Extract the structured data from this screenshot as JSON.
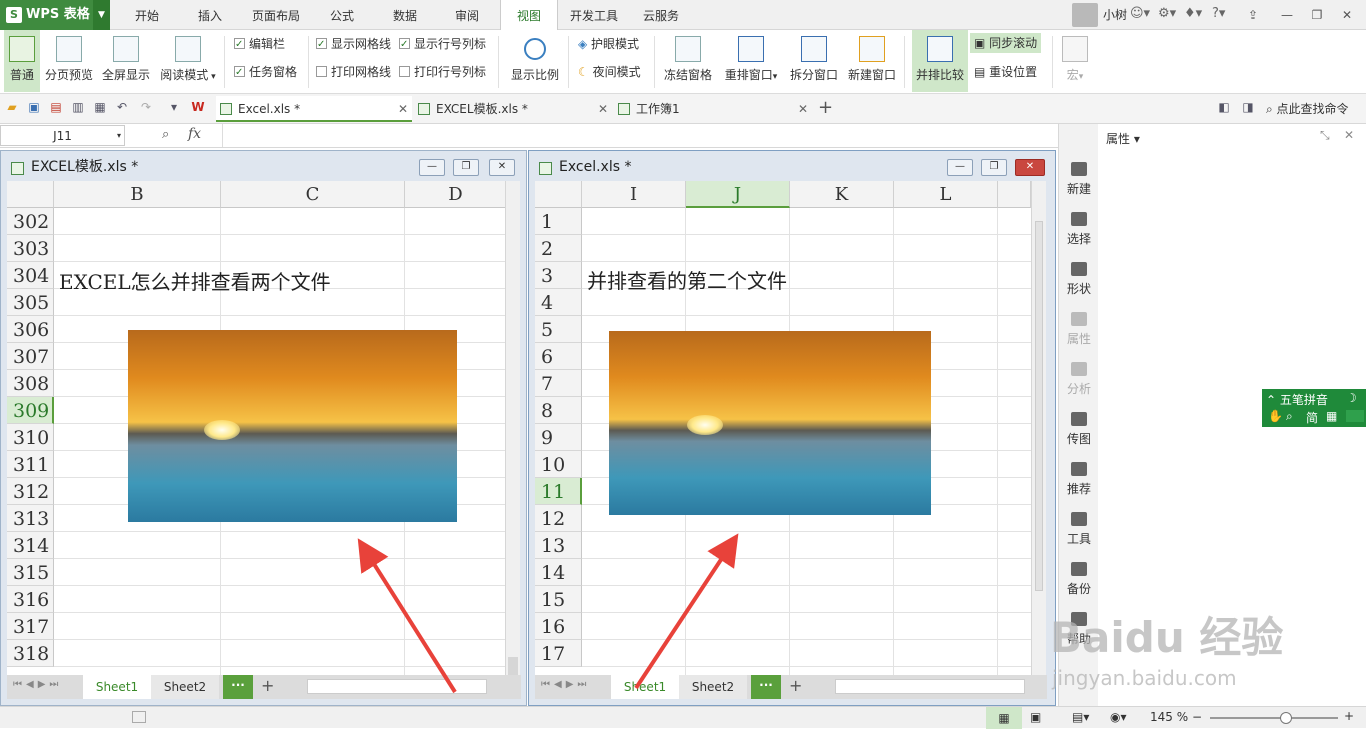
{
  "app": {
    "name": "WPS 表格"
  },
  "menu": {
    "tabs": [
      "开始",
      "插入",
      "页面布局",
      "公式",
      "数据",
      "审阅",
      "视图",
      "开发工具",
      "云服务"
    ],
    "active": "视图"
  },
  "user": {
    "name": "小树"
  },
  "ribbon": {
    "view_buttons": [
      "普通",
      "分页预览",
      "全屏显示",
      "阅读模式"
    ],
    "checkboxes_col1": [
      {
        "label": "编辑栏",
        "checked": true
      },
      {
        "label": "任务窗格",
        "checked": true
      }
    ],
    "checkboxes_col2": [
      {
        "label": "显示网格线",
        "checked": true
      },
      {
        "label": "打印网格线",
        "checked": false
      }
    ],
    "checkboxes_col3": [
      {
        "label": "显示行号列标",
        "checked": true
      },
      {
        "label": "打印行号列标",
        "checked": false
      }
    ],
    "zoom_button": "显示比例",
    "eye_mode": "护眼模式",
    "night_mode": "夜间模式",
    "freeze": "冻结窗格",
    "rearrange": "重排窗口",
    "split": "拆分窗口",
    "new_window": "新建窗口",
    "side_by_side": "并排比较",
    "sync_scroll": "同步滚动",
    "reset_pos": "重设位置",
    "macro": "宏"
  },
  "doc_tabs": [
    "Excel.xls *",
    "EXCEL模板.xls *",
    "工作簿1"
  ],
  "search_cmd": "点此查找命令",
  "formula_bar": {
    "name_box": "J11",
    "fx": "fx"
  },
  "window_left": {
    "title": "EXCEL模板.xls *",
    "columns": [
      "B",
      "C",
      "D"
    ],
    "rows": [
      "302",
      "303",
      "304",
      "305",
      "306",
      "307",
      "308",
      "309",
      "310",
      "311",
      "312",
      "313",
      "314",
      "315",
      "316",
      "317",
      "318"
    ],
    "selected_row": "309",
    "cell_text": "EXCEL怎么并排查看两个文件",
    "sheets": [
      "Sheet1",
      "Sheet2"
    ],
    "active_sheet": "Sheet1"
  },
  "window_right": {
    "title": "Excel.xls *",
    "columns": [
      "I",
      "J",
      "K",
      "L"
    ],
    "selected_col": "J",
    "rows": [
      "1",
      "2",
      "3",
      "4",
      "5",
      "6",
      "7",
      "8",
      "9",
      "10",
      "11",
      "12",
      "13",
      "14",
      "15",
      "16",
      "17"
    ],
    "selected_row": "11",
    "cell_text": "并排查看的第二个文件",
    "sheets": [
      "Sheet1",
      "Sheet2"
    ],
    "active_sheet": "Sheet1"
  },
  "sidebar": {
    "items": [
      {
        "label": "新建",
        "enabled": true
      },
      {
        "label": "选择",
        "enabled": true
      },
      {
        "label": "形状",
        "enabled": true
      },
      {
        "label": "属性",
        "enabled": false
      },
      {
        "label": "分析",
        "enabled": false
      },
      {
        "label": "传图",
        "enabled": true
      },
      {
        "label": "推荐",
        "enabled": true
      },
      {
        "label": "工具",
        "enabled": true
      },
      {
        "label": "备份",
        "enabled": true
      },
      {
        "label": "帮助",
        "enabled": true
      }
    ]
  },
  "properties_panel": {
    "title": "属性"
  },
  "status": {
    "zoom": "145 %"
  },
  "ime": {
    "name": "五笔拼音",
    "mode": "简"
  },
  "watermark": {
    "brand": "Baidu 经验",
    "url": "jingyan.baidu.com"
  }
}
